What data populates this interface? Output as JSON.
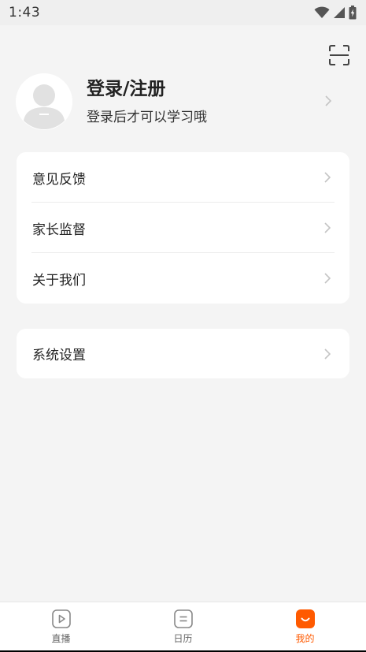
{
  "status_bar": {
    "time": "1:43"
  },
  "profile": {
    "title": "登录/注册",
    "subtitle": "登录后才可以学习哦"
  },
  "menu_card": {
    "items": [
      {
        "label": "意见反馈"
      },
      {
        "label": "家长监督"
      },
      {
        "label": "关于我们"
      }
    ]
  },
  "settings_card": {
    "items": [
      {
        "label": "系统设置"
      }
    ]
  },
  "tab_bar": {
    "tabs": [
      {
        "label": "直播",
        "icon": "play-icon",
        "active": false
      },
      {
        "label": "日历",
        "icon": "calendar-icon",
        "active": false
      },
      {
        "label": "我的",
        "icon": "smile-icon",
        "active": true
      }
    ]
  },
  "colors": {
    "accent": "#ff5a00",
    "background": "#f4f4f4",
    "card": "#ffffff"
  }
}
